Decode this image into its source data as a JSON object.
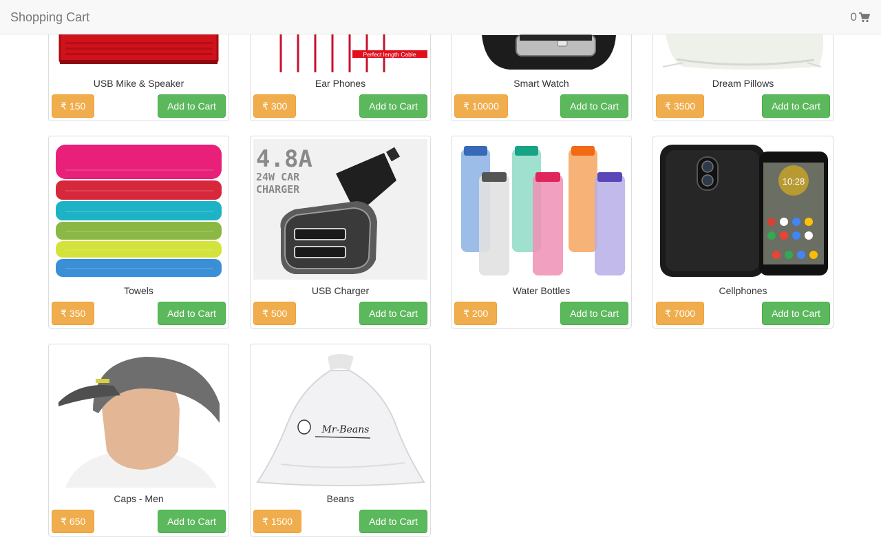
{
  "navbar": {
    "brand": "Shopping Cart",
    "cart_count": "0",
    "cart_icon": "shopping-cart-icon"
  },
  "currency_symbol": "₹",
  "add_label": "Add to Cart",
  "products": [
    {
      "name": "USB Mike & Speaker",
      "price": "150",
      "image": "speaker-image"
    },
    {
      "name": "Ear Phones",
      "price": "300",
      "image": "earphones-image",
      "image_caption": "Perfect length Cable"
    },
    {
      "name": "Smart Watch",
      "price": "10000",
      "image": "smartwatch-image"
    },
    {
      "name": "Dream Pillows",
      "price": "3500",
      "image": "pillow-image"
    },
    {
      "name": "Towels",
      "price": "350",
      "image": "towels-image"
    },
    {
      "name": "USB Charger",
      "price": "500",
      "image": "charger-image",
      "image_caption_line1": "4.8A",
      "image_caption_line2": "24W CAR",
      "image_caption_line3": "CHARGER"
    },
    {
      "name": "Water Bottles",
      "price": "200",
      "image": "bottles-image"
    },
    {
      "name": "Cellphones",
      "price": "7000",
      "image": "cellphone-image",
      "image_caption": "10:28"
    },
    {
      "name": "Caps - Men",
      "price": "650",
      "image": "cap-image"
    },
    {
      "name": "Beans",
      "price": "1500",
      "image": "beans-bag-image",
      "image_caption": "Mr-Beans"
    }
  ],
  "colors": {
    "price_badge": "#f0ad4e",
    "add_button": "#5cb85c",
    "navbar_bg": "#f8f8f8"
  }
}
